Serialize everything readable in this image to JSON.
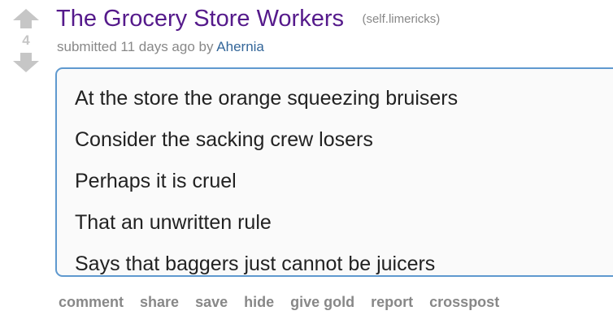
{
  "post": {
    "score": "4",
    "title": "The Grocery Store Workers",
    "domain": "(self.limericks)",
    "tagline_prefix": "submitted 11 days ago by",
    "author": "Ahernia",
    "body_lines": [
      "At the store the orange squeezing bruisers",
      "Consider the sacking crew losers",
      "Perhaps it is cruel",
      "That an unwritten rule",
      "Says that baggers just cannot be juicers"
    ]
  },
  "buttons": {
    "comment": "comment",
    "share": "share",
    "save": "save",
    "hide": "hide",
    "give_gold": "give gold",
    "report": "report",
    "crosspost": "crosspost"
  },
  "icons": {
    "upvote": "upvote-arrow-icon",
    "downvote": "downvote-arrow-icon"
  },
  "colors": {
    "arrow": "#c6c6c6",
    "title": "#551a8b",
    "author": "#336699",
    "selftext_border": "#5f99cf"
  }
}
